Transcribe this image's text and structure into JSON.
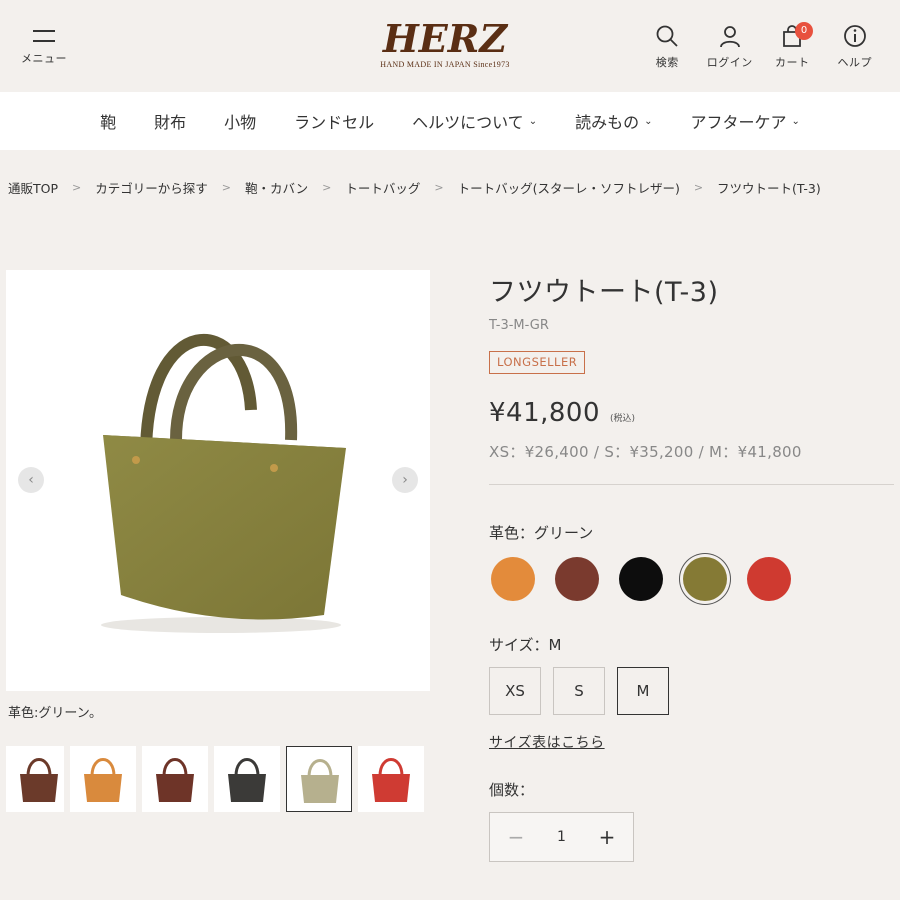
{
  "header": {
    "menu_label": "メニュー",
    "logo_text": "HERZ",
    "logo_sub": "HAND MADE IN JAPAN Since1973",
    "icons": [
      {
        "icon": "search-icon",
        "label": "検索"
      },
      {
        "icon": "user-icon",
        "label": "ログイン"
      },
      {
        "icon": "cart-icon",
        "label": "カート",
        "badge": "0"
      },
      {
        "icon": "info-icon",
        "label": "ヘルプ"
      }
    ]
  },
  "nav": {
    "items": [
      {
        "label": "鞄",
        "dropdown": false
      },
      {
        "label": "財布",
        "dropdown": false
      },
      {
        "label": "小物",
        "dropdown": false
      },
      {
        "label": "ランドセル",
        "dropdown": false
      },
      {
        "label": "ヘルツについて",
        "dropdown": true
      },
      {
        "label": "読みもの",
        "dropdown": true
      },
      {
        "label": "アフターケア",
        "dropdown": true
      }
    ]
  },
  "breadcrumb": [
    "通販TOP",
    "カテゴリーから探す",
    "鞄・カバン",
    "トートバッグ",
    "トートバッグ(スターレ・ソフトレザー)",
    "フツウトート(T-3)"
  ],
  "gallery": {
    "caption": "革色:グリーン。",
    "main_color": "#8a8540",
    "thumbs": [
      {
        "color": "#6b3a2a"
      },
      {
        "color": "#d98a3d"
      },
      {
        "color": "#6e3428"
      },
      {
        "color": "#3b3a38"
      },
      {
        "color": "#b6b08e"
      },
      {
        "color": "#cf3b33"
      },
      {
        "color": "#2b2b2b"
      }
    ],
    "active_thumb": 4
  },
  "product": {
    "title": "フツウトート(T-3)",
    "sku": "T-3-M-GR",
    "badge": "LONGSELLER",
    "price": "¥41,800",
    "tax_note": "(税込)",
    "price_variants": "XS：¥26,400 / S：¥35,200 / M：¥41,800",
    "color_label": "革色：グリーン",
    "colors": [
      "#e38b3b",
      "#7a3a2e",
      "#0d0d0d",
      "#857a35",
      "#cf3a30"
    ],
    "selected_color": 3,
    "size_label": "サイズ：M",
    "sizes": [
      "XS",
      "S",
      "M"
    ],
    "selected_size": 2,
    "size_chart_link": "サイズ表はこちら",
    "qty_label": "個数：",
    "qty_value": "1"
  }
}
